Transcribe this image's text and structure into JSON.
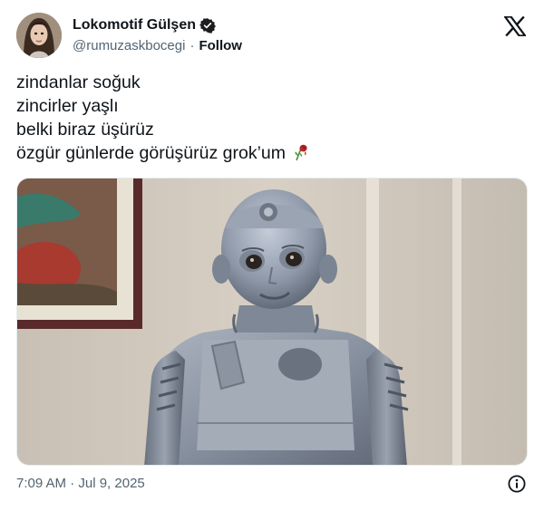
{
  "author": {
    "display_name": "Lokomotif Gülşen",
    "handle": "@rumuzaskbocegi",
    "separator": "·",
    "follow_label": "Follow",
    "verified": true
  },
  "tweet": {
    "lines": [
      "zindanlar soğuk",
      "zincirler yaşlı",
      "belki biraz üşürüz",
      "özgür günlerde görüşürüz grok’um"
    ],
    "emoji": "wilted-rose"
  },
  "footer": {
    "timestamp": "7:09 AM · Jul 9, 2025"
  },
  "icons": {
    "platform_logo": "x-logo-icon",
    "verified": "verified-badge-icon",
    "info": "info-icon"
  },
  "colors": {
    "text": "#0f1419",
    "secondary": "#536471",
    "verified_badge": "#1d1d1f"
  }
}
